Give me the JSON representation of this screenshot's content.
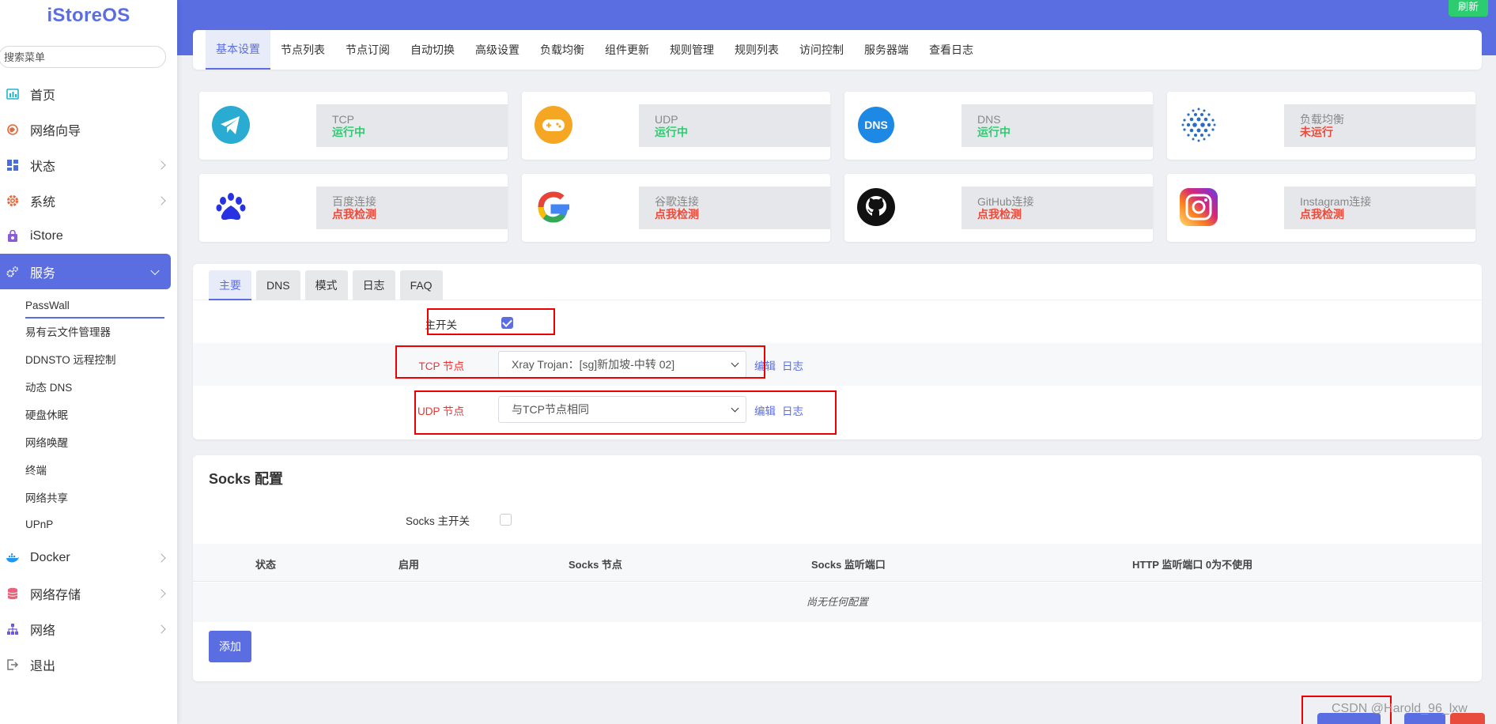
{
  "app": {
    "logo": "iStoreOS"
  },
  "sidebar": {
    "search_placeholder": "搜索菜单",
    "items": [
      {
        "label": "首页",
        "icon": "dashboard-icon"
      },
      {
        "label": "网络向导",
        "icon": "globe-pin-icon"
      },
      {
        "label": "状态",
        "icon": "grid-icon"
      },
      {
        "label": "系统",
        "icon": "gear-icon"
      },
      {
        "label": "iStore",
        "icon": "store-icon"
      },
      {
        "label": "服务",
        "icon": "services-icon"
      }
    ],
    "sub_items": [
      "PassWall",
      "易有云文件管理器",
      "DDNSTO 远程控制",
      "动态 DNS",
      "硬盘休眠",
      "网络唤醒",
      "终端",
      "网络共享",
      "UPnP"
    ],
    "bottom_items": [
      {
        "label": "Docker",
        "icon": "docker-icon"
      },
      {
        "label": "网络存储",
        "icon": "database-icon"
      },
      {
        "label": "网络",
        "icon": "network-icon"
      },
      {
        "label": "退出",
        "icon": "logout-icon"
      }
    ]
  },
  "topbar": {
    "refresh": "刷新"
  },
  "tabs": [
    "基本设置",
    "节点列表",
    "节点订阅",
    "自动切换",
    "高级设置",
    "负载均衡",
    "组件更新",
    "规则管理",
    "规则列表",
    "访问控制",
    "服务器端",
    "查看日志"
  ],
  "status_cards": [
    {
      "name": "TCP",
      "state": "运行中",
      "icon": "telegram-icon"
    },
    {
      "name": "UDP",
      "state": "运行中",
      "icon": "gamepad-icon"
    },
    {
      "name": "DNS",
      "state": "运行中",
      "icon": "dns-icon",
      "icon_text": "DNS"
    },
    {
      "name": "负载均衡",
      "state": "未运行",
      "icon": "dots-sphere-icon"
    },
    {
      "name": "百度连接",
      "state": "点我检测",
      "icon": "baidu-paw-icon"
    },
    {
      "name": "谷歌连接",
      "state": "点我检测",
      "icon": "google-icon"
    },
    {
      "name": "GitHub连接",
      "state": "点我检测",
      "icon": "github-icon"
    },
    {
      "name": "Instagram连接",
      "state": "点我检测",
      "icon": "instagram-icon"
    }
  ],
  "subtabs": [
    "主要",
    "DNS",
    "模式",
    "日志",
    "FAQ"
  ],
  "form": {
    "main_switch_label": "主开关",
    "tcp_label": "TCP 节点",
    "tcp_value": "Xray Trojan：[sg]新加坡-中转 02]",
    "udp_label": "UDP 节点",
    "udp_value": "与TCP节点相同",
    "edit": "编辑",
    "log": "日志"
  },
  "socks": {
    "title": "Socks 配置",
    "switch_label": "Socks 主开关",
    "columns": [
      "状态",
      "启用",
      "Socks 节点",
      "Socks 监听端口",
      "HTTP 监听端口 0为不使用"
    ],
    "empty": "尚无任何配置",
    "add": "添加"
  },
  "watermark": "CSDN @Harold_96_lxw",
  "colors": {
    "accent": "#5b6ee1",
    "ok": "#2ecc71",
    "bad": "#e74c3c"
  }
}
